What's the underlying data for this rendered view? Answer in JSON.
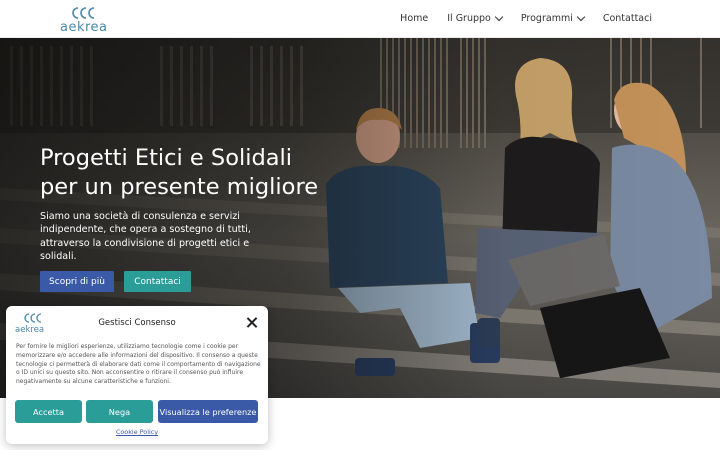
{
  "brand": {
    "name": "aekrea"
  },
  "nav": {
    "items": [
      {
        "label": "Home",
        "has_dropdown": false
      },
      {
        "label": "Il Gruppo",
        "has_dropdown": true
      },
      {
        "label": "Programmi",
        "has_dropdown": true
      },
      {
        "label": "Contattaci",
        "has_dropdown": false
      }
    ]
  },
  "hero": {
    "title_line1": "Progetti Etici e Solidali",
    "title_line2": "per un presente migliore",
    "text": "Siamo una società di consulenza e servizi indipendente, che opera a sostegno di tutti, attraverso la condivisione di progetti etici e solidali.",
    "primary_label": "Scopri di più",
    "secondary_label": "Contattaci"
  },
  "cookie": {
    "title": "Gestisci Consenso",
    "text": "Per fornire le migliori esperienze, utilizziamo tecnologie come i cookie per memorizzare e/o accedere alle informazioni del dispositivo. Il consenso a queste tecnologie ci permetterà di elaborare dati come il comportamento di navigazione o ID unici su questo sito. Non acconsentire o ritirare il consenso può influire negativamente su alcune caratteristiche e funzioni.",
    "accept_label": "Accetta",
    "deny_label": "Nega",
    "prefs_label": "Visualizza le preferenze",
    "policy_label": "Cookie Policy"
  },
  "colors": {
    "primary": "#3a5aa8",
    "teal": "#2a9d98",
    "logo": "#4a88a8"
  }
}
